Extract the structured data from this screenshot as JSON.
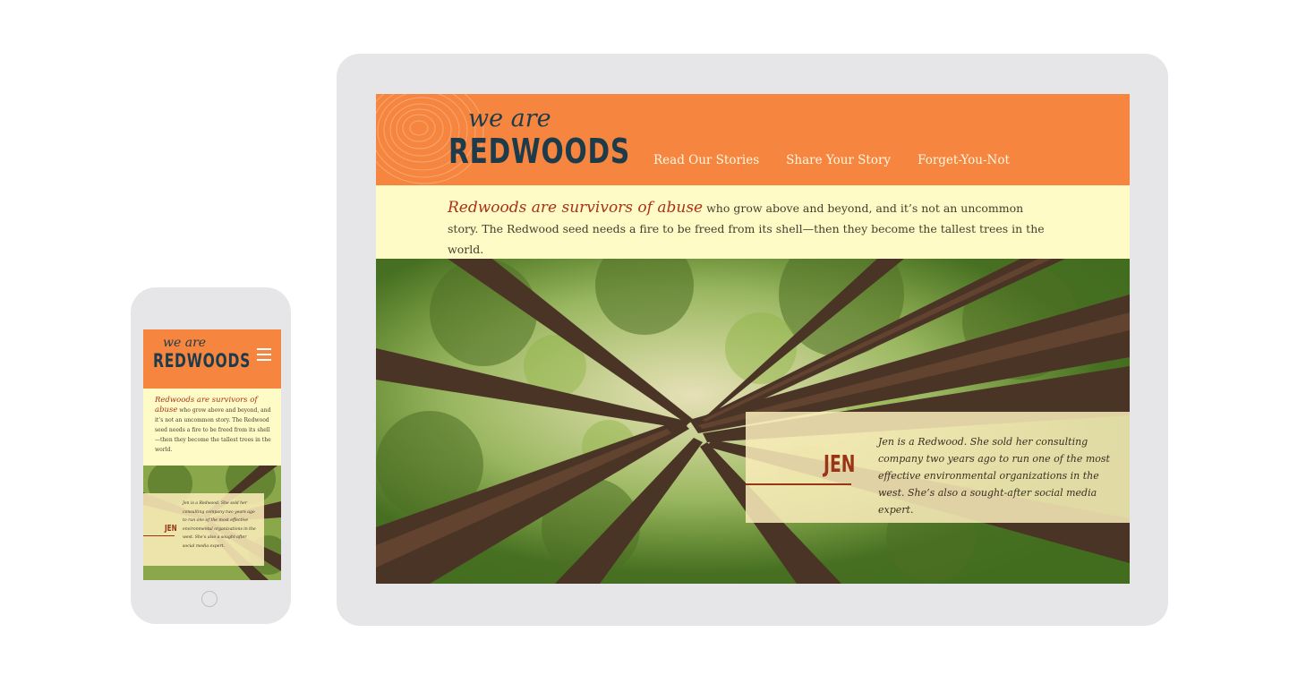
{
  "brand": {
    "logo_top": "we are",
    "logo_bottom": "REDWOODS"
  },
  "nav": [
    "Read Our Stories",
    "Share Your Story",
    "Forget-You-Not"
  ],
  "intro": {
    "lead": "Redwoods are survivors of abuse",
    "body": " who grow above and beyond, and it’s not an uncommon story. The Redwood seed needs a fire to be freed from its shell—then they become the tallest trees in the world."
  },
  "feature": {
    "name": "JEN",
    "text": "Jen is a Redwood. She sold her consulting company two years ago to run one of the most effective environmental organizations in the west. She’s also a sought-after social media expert."
  },
  "icons": {
    "menu": "hamburger-icon",
    "home": "home-button-icon"
  },
  "colors": {
    "header": "#f5853f",
    "intro_bg": "#fffbc6",
    "accent": "#a8331a",
    "logo": "#1d3b4a",
    "device": "#e6e6e8"
  }
}
